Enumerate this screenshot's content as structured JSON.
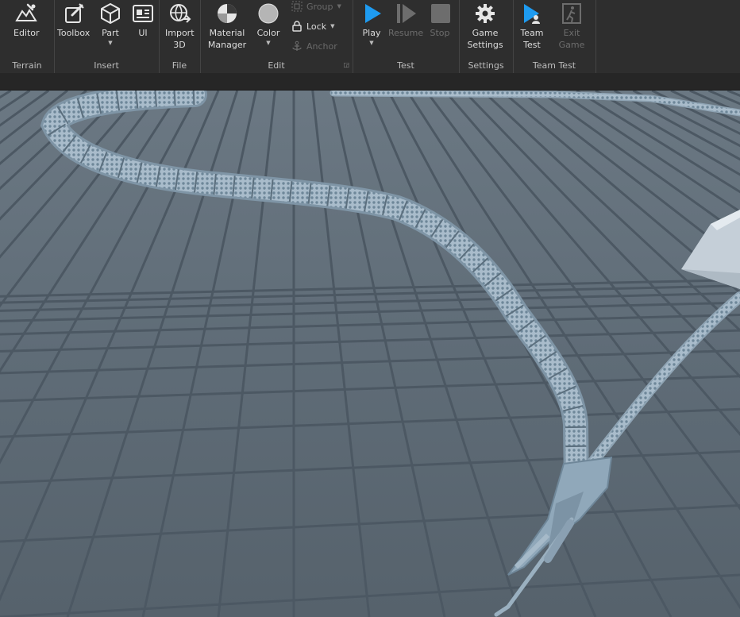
{
  "ribbon": {
    "groups": [
      {
        "label": "Terrain",
        "tools": [
          {
            "label": "Editor",
            "icon": "terrain-editor-icon"
          }
        ]
      },
      {
        "label": "Insert",
        "tools": [
          {
            "label": "Toolbox",
            "icon": "toolbox-icon"
          },
          {
            "label": "Part",
            "icon": "part-cube-icon"
          },
          {
            "label": "UI",
            "icon": "ui-icon"
          }
        ]
      },
      {
        "label": "File",
        "tools": [
          {
            "label": "Import 3D",
            "icon": "import-3d-icon"
          }
        ]
      },
      {
        "label": "Edit",
        "tools": [
          {
            "label": "Material Manager",
            "icon": "material-manager-icon"
          },
          {
            "label": "Color",
            "icon": "color-icon"
          }
        ],
        "mini": [
          {
            "label": "Group"
          },
          {
            "label": "Lock"
          },
          {
            "label": "Anchor"
          }
        ]
      },
      {
        "label": "Test",
        "tools": [
          {
            "label": "Play",
            "icon": "play-icon"
          },
          {
            "label": "Resume",
            "icon": "resume-icon"
          },
          {
            "label": "Stop",
            "icon": "stop-icon"
          }
        ]
      },
      {
        "label": "Settings",
        "tools": [
          {
            "label": "Game Settings",
            "icon": "gear-icon"
          }
        ]
      },
      {
        "label": "Team Test",
        "tools": [
          {
            "label": "Team Test",
            "icon": "team-test-icon"
          },
          {
            "label": "Exit Game",
            "icon": "exit-game-icon"
          }
        ]
      }
    ]
  },
  "colors": {
    "ribbon_bg": "#2e2e2e",
    "accent_play": "#1e9bf0",
    "floor": "#5d6a75",
    "grid_line": "#4c5863",
    "snake": "#a9bccb"
  }
}
